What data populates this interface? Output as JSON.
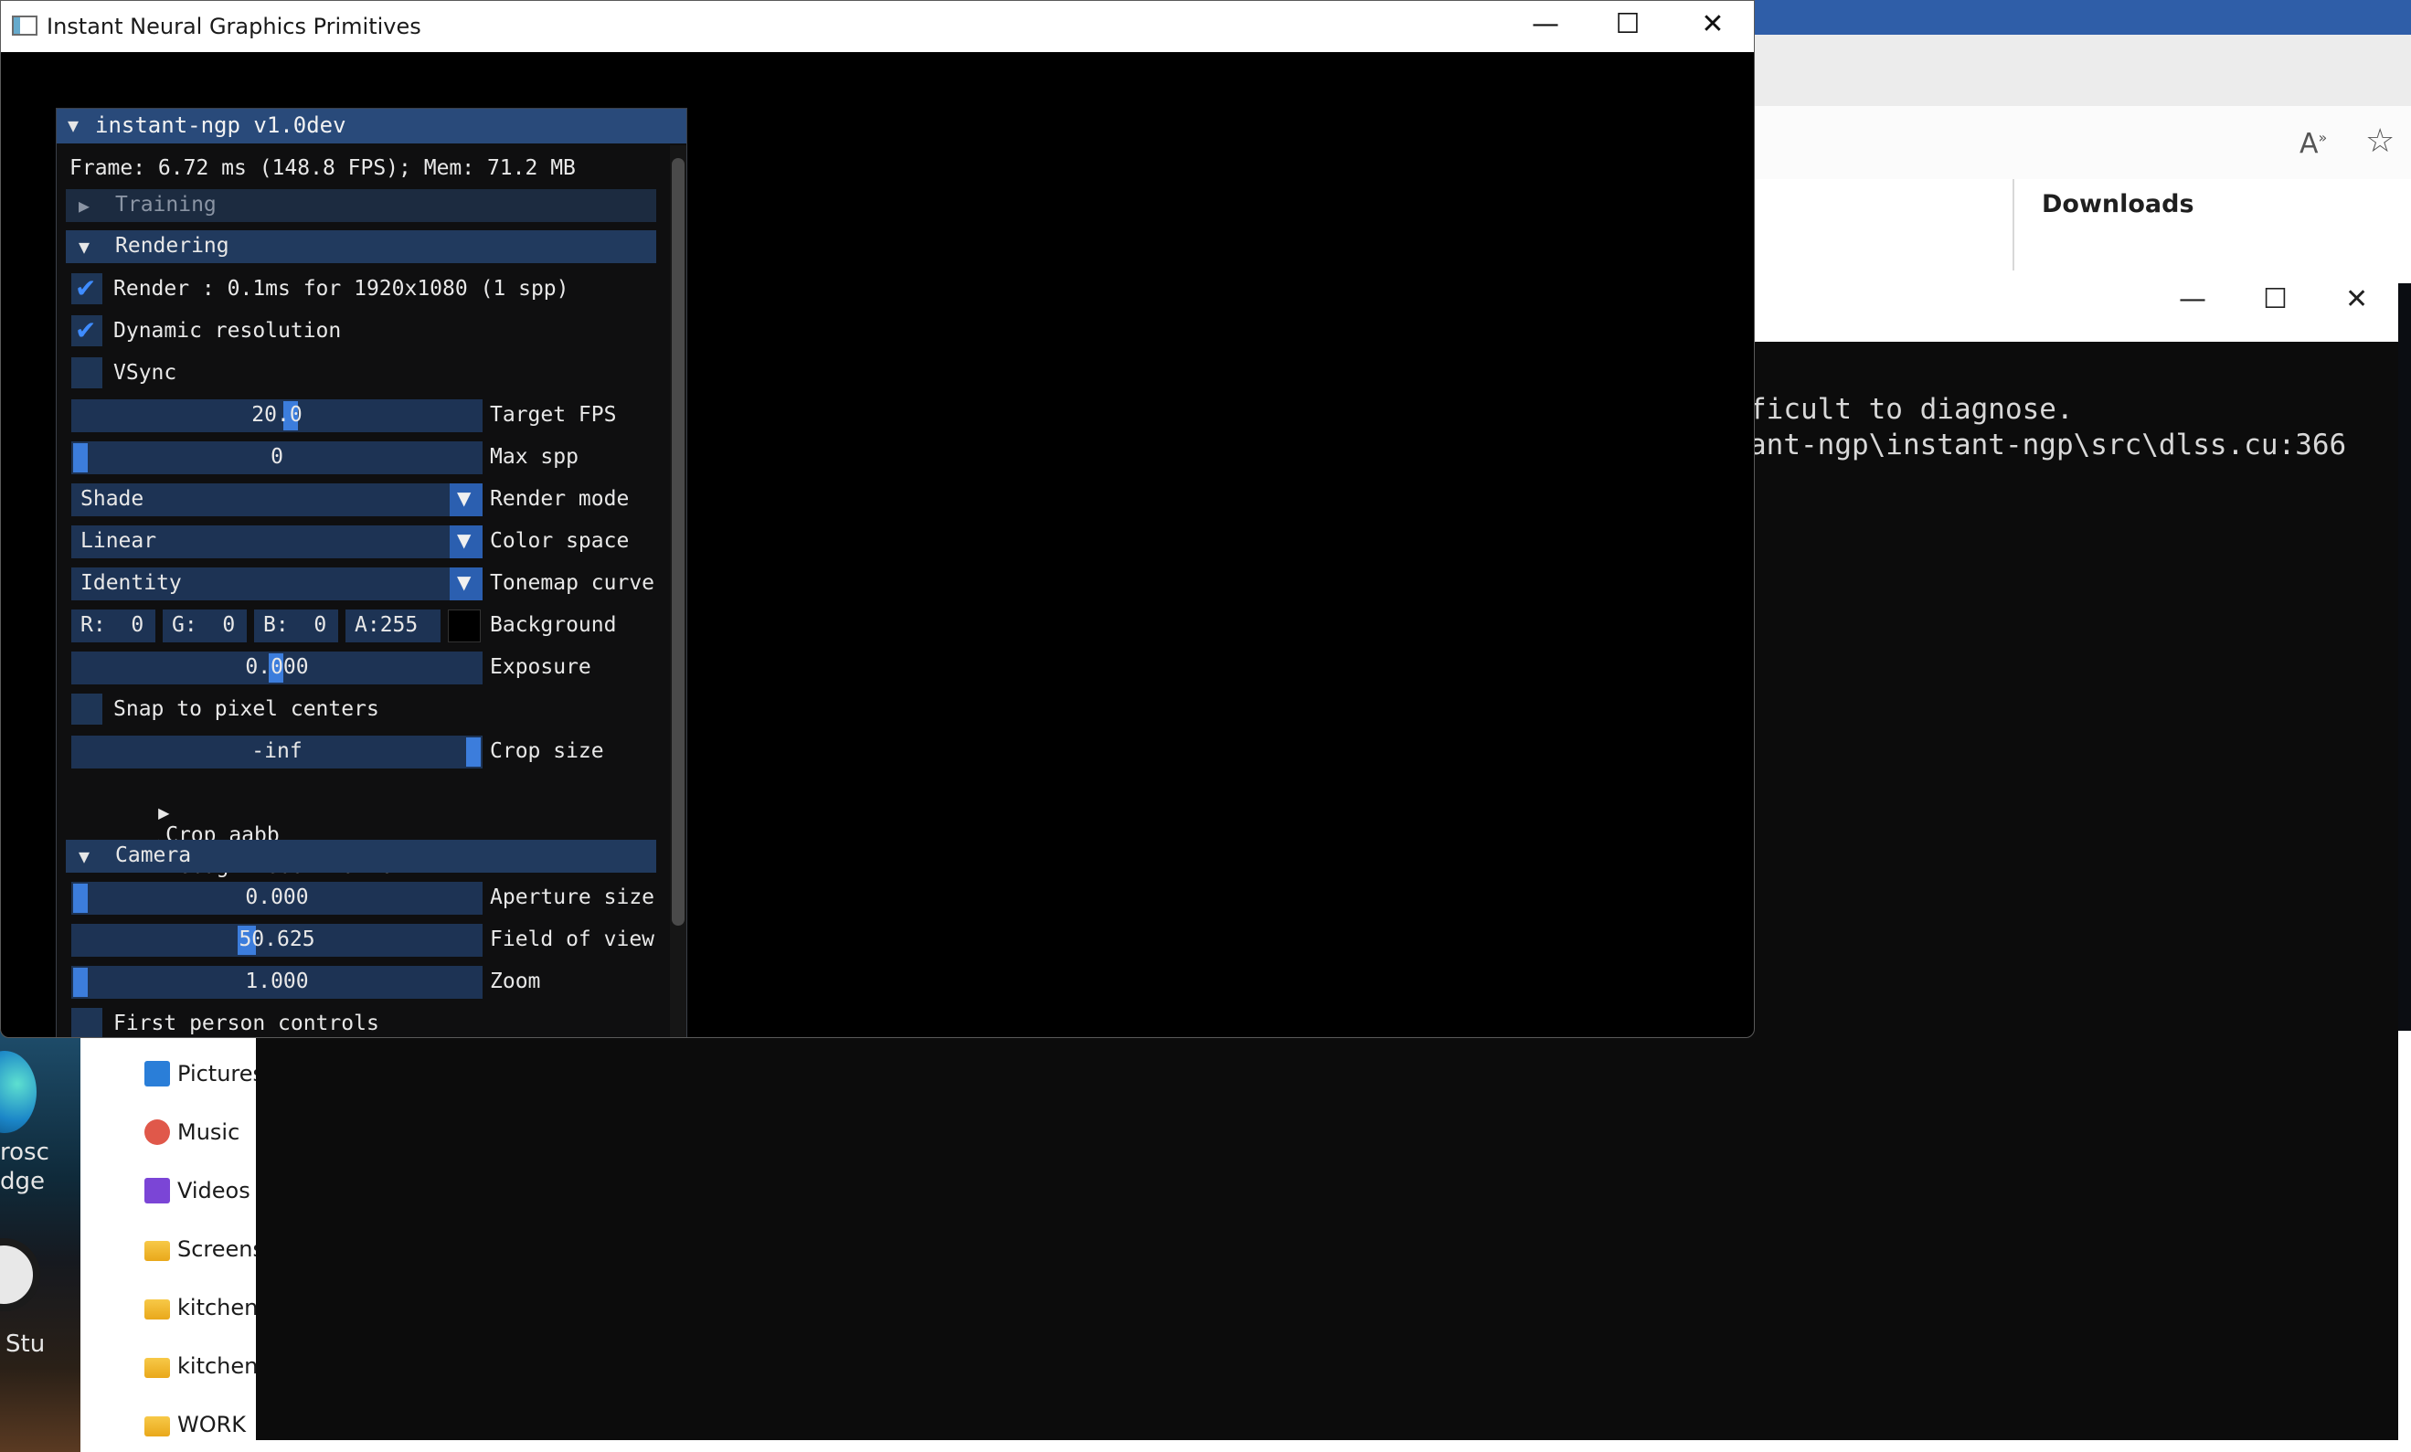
{
  "app": {
    "title": "Instant Neural Graphics Primitives",
    "window_controls": [
      "minimize",
      "maximize",
      "close"
    ]
  },
  "panel": {
    "title": "instant-ngp v1.0dev",
    "frame_stats": "Frame: 6.72 ms (148.8 FPS); Mem: 71.2 MB",
    "sections": {
      "training": "Training",
      "rendering": "Rendering",
      "camera": "Camera"
    },
    "rendering": {
      "render_label": "Render : 0.1ms for 1920x1080 (1 spp)",
      "render_checked": true,
      "dynamic_resolution_label": "Dynamic resolution",
      "dynamic_resolution_checked": true,
      "vsync_label": "VSync",
      "vsync_checked": false,
      "target_fps": {
        "value": "20.0",
        "label": "Target FPS"
      },
      "max_spp": {
        "value": "0",
        "label": "Max spp"
      },
      "render_mode": {
        "value": "Shade",
        "label": "Render mode"
      },
      "color_space": {
        "value": "Linear",
        "label": "Color space"
      },
      "tonemap_curve": {
        "value": "Identity",
        "label": "Tonemap curve"
      },
      "background": {
        "r": "R:  0",
        "g": "G:  0",
        "b": "B:  0",
        "a": "A:255",
        "label": "Background",
        "swatch": "#000000"
      },
      "exposure": {
        "value": "0.000",
        "label": "Exposure"
      },
      "snap_label": "Snap to pixel centers",
      "snap_checked": false,
      "crop_size": {
        "value": "-inf",
        "label": "Crop size"
      },
      "crop_aabb": "Crop aabb",
      "debug_visualization": "Debug visualization"
    },
    "camera": {
      "aperture": {
        "value": "0.000",
        "label": "Aperture size"
      },
      "fov": {
        "value": "50.625",
        "label": "Field of view"
      },
      "zoom": {
        "value": "1.000",
        "label": "Zoom"
      },
      "first_person_label": "First person controls",
      "first_person_checked": false
    }
  },
  "browser": {
    "downloads_title": "Downloads"
  },
  "terminal": {
    "lines": [
      "ficult to diagnose.",
      "ant-ngp\\instant-ngp\\src\\dlss.cu:366"
    ]
  },
  "explorer": {
    "items": [
      "Pictures",
      "Music",
      "Videos",
      "Screensh",
      "kitchen",
      "kitchen",
      "WORK"
    ]
  },
  "desktop": {
    "labels": [
      "rosc",
      "dge",
      "Stu"
    ]
  },
  "colors": {
    "imgui_header": "#294a7a",
    "imgui_frame": "#1d3354",
    "imgui_accent": "#3c7ddc",
    "terminal_bg": "#0c0c0c"
  }
}
